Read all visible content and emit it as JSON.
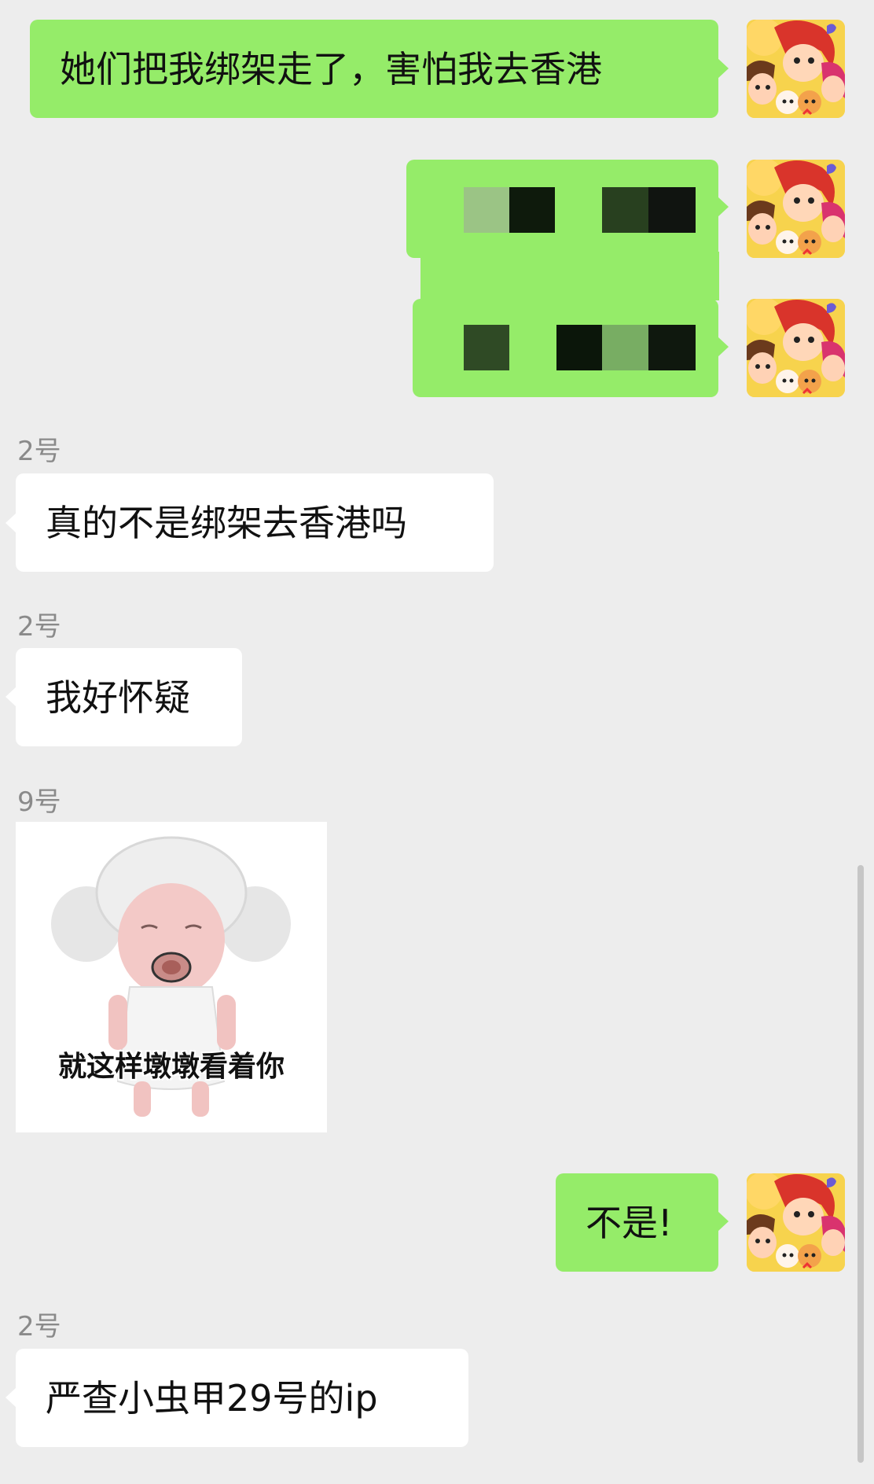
{
  "messages": {
    "m1": {
      "text": "她们把我绑架走了，害怕我去香港"
    },
    "m4": {
      "sender": "2号",
      "text": "真的不是绑架去香港吗"
    },
    "m5": {
      "sender": "2号",
      "text": "我好怀疑"
    },
    "m6": {
      "sender": "9号",
      "sticker_caption": "就这样墩墩看着你"
    },
    "m7": {
      "text": "不是!"
    },
    "m8": {
      "sender": "2号",
      "text": "严查小虫甲29号的ip"
    }
  },
  "colors": {
    "background": "#ededed",
    "outgoing_bubble": "#95ec69",
    "incoming_bubble": "#ffffff",
    "sender_name": "#8a8a8a"
  }
}
